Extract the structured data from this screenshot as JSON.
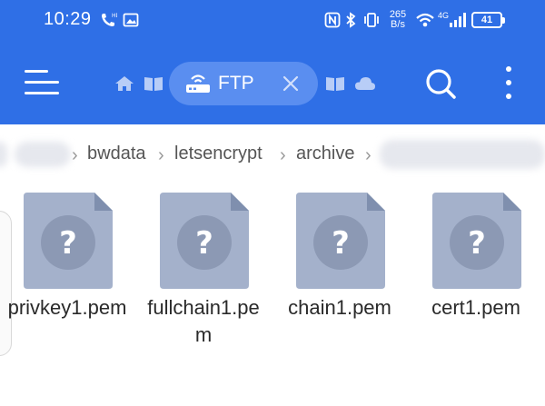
{
  "status_bar": {
    "time": "10:29",
    "net_speed_top": "265",
    "net_speed_bottom": "B/s",
    "signal_label": "4G",
    "battery": "41",
    "icons": [
      "call-icon",
      "image-icon",
      "nfc-icon",
      "bluetooth-icon",
      "vibrate-icon",
      "wifi-icon",
      "signal-icon",
      "battery-icon"
    ]
  },
  "toolbar": {
    "tab_label": "FTP",
    "icons": [
      "menu-icon",
      "home-icon",
      "book-icon",
      "ftp-router-icon",
      "close-icon",
      "book-icon",
      "cloud-icon",
      "search-icon",
      "more-vertical-icon"
    ]
  },
  "breadcrumb": {
    "items": [
      "bwdata",
      "letsencrypt",
      "archive"
    ]
  },
  "files": [
    {
      "name": "privkey1.pem",
      "icon": "unknown-file-icon"
    },
    {
      "name": "fullchain1.pem",
      "icon": "unknown-file-icon"
    },
    {
      "name": "chain1.pem",
      "icon": "unknown-file-icon"
    },
    {
      "name": "cert1.pem",
      "icon": "unknown-file-icon"
    }
  ],
  "colors": {
    "accent": "#2f6fe6",
    "tab_pill": "#5a8ef0",
    "file_icon": "#a4b1cb",
    "file_fold": "#7f8fae"
  }
}
